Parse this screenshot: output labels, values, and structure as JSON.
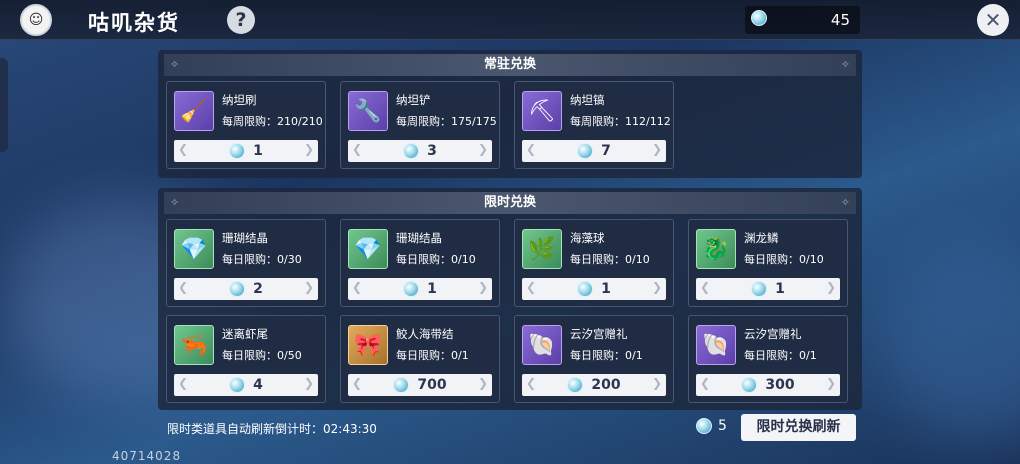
{
  "header": {
    "title": "咕叽杂货",
    "help_symbol": "?",
    "currency_value": "45",
    "close_symbol": "✕"
  },
  "permanent": {
    "title": "常驻兑换",
    "items": [
      {
        "name": "纳坦刷",
        "limit": "每周限购：210/210",
        "price": "1",
        "icon": "brush-icon",
        "frame": "purple",
        "glyph": "🧹"
      },
      {
        "name": "纳坦铲",
        "limit": "每周限购：175/175",
        "price": "3",
        "icon": "shovel-icon",
        "frame": "purple",
        "glyph": "🔧"
      },
      {
        "name": "纳坦镐",
        "limit": "每周限购：112/112",
        "price": "7",
        "icon": "pickaxe-icon",
        "frame": "purple",
        "glyph": "⛏"
      }
    ]
  },
  "limited": {
    "title": "限时兑换",
    "items": [
      {
        "name": "珊瑚结晶",
        "limit": "每日限购：0/30",
        "price": "2",
        "icon": "coral-crystal-icon",
        "frame": "green",
        "glyph": "💎"
      },
      {
        "name": "珊瑚结晶",
        "limit": "每日限购：0/10",
        "price": "1",
        "icon": "coral-crystal-icon",
        "frame": "green",
        "glyph": "💎"
      },
      {
        "name": "海藻球",
        "limit": "每日限购：0/10",
        "price": "1",
        "icon": "seaweed-ball-icon",
        "frame": "green",
        "glyph": "🌿"
      },
      {
        "name": "渊龙鳞",
        "limit": "每日限购：0/10",
        "price": "1",
        "icon": "dragon-scale-icon",
        "frame": "green",
        "glyph": "🐉"
      },
      {
        "name": "迷离虾尾",
        "limit": "每日限购：0/50",
        "price": "4",
        "icon": "shrimp-tail-icon",
        "frame": "green",
        "glyph": "🦐"
      },
      {
        "name": "鲛人海带结",
        "limit": "每日限购：0/1",
        "price": "700",
        "icon": "kelp-knot-icon",
        "frame": "gold",
        "glyph": "🎀"
      },
      {
        "name": "云汐宫赠礼",
        "limit": "每日限购：0/1",
        "price": "200",
        "icon": "conch-gift-icon",
        "frame": "purple",
        "glyph": "🐚"
      },
      {
        "name": "云汐宫赠礼",
        "limit": "每日限购：0/1",
        "price": "300",
        "icon": "conch-gift-icon",
        "frame": "purple",
        "glyph": "🐚"
      }
    ]
  },
  "footer": {
    "refresh_text": "限时类道具自动刷新倒计时：02:43:30",
    "refresh_cost": "5",
    "refresh_button": "限时兑换刷新",
    "uid": "40714028"
  },
  "colors": {
    "accent_gem": "#9bd9ec",
    "card_bg": "#202c44",
    "button_bg": "#f4f5f8"
  }
}
